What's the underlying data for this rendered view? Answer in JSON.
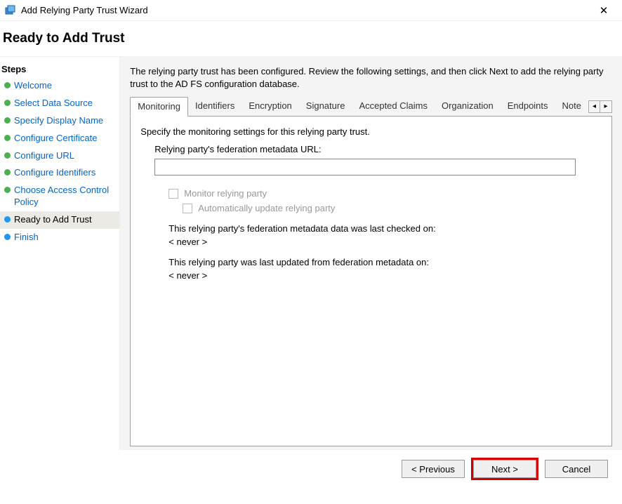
{
  "window": {
    "title": "Add Relying Party Trust Wizard"
  },
  "header": "Ready to Add Trust",
  "sidebar": {
    "title": "Steps",
    "steps": [
      {
        "label": "Welcome",
        "state": "done"
      },
      {
        "label": "Select Data Source",
        "state": "done"
      },
      {
        "label": "Specify Display Name",
        "state": "done"
      },
      {
        "label": "Configure Certificate",
        "state": "done"
      },
      {
        "label": "Configure URL",
        "state": "done"
      },
      {
        "label": "Configure Identifiers",
        "state": "done"
      },
      {
        "label": "Choose Access Control Policy",
        "state": "done"
      },
      {
        "label": "Ready to Add Trust",
        "state": "current"
      },
      {
        "label": "Finish",
        "state": "pending"
      }
    ]
  },
  "main": {
    "intro": "The relying party trust has been configured. Review the following settings, and then click Next to add the relying party trust to the AD FS configuration database.",
    "tabs": [
      {
        "label": "Monitoring",
        "active": true
      },
      {
        "label": "Identifiers"
      },
      {
        "label": "Encryption"
      },
      {
        "label": "Signature"
      },
      {
        "label": "Accepted Claims"
      },
      {
        "label": "Organization"
      },
      {
        "label": "Endpoints"
      },
      {
        "label": "Note"
      }
    ],
    "monitoring": {
      "desc": "Specify the monitoring settings for this relying party trust.",
      "url_label": "Relying party's federation metadata URL:",
      "url_value": "",
      "cb_monitor": "Monitor relying party",
      "cb_autoupdate": "Automatically update relying party",
      "last_checked_label": "This relying party's federation metadata data was last checked on:",
      "last_checked_value": "< never >",
      "last_updated_label": "This relying party was last updated from federation metadata on:",
      "last_updated_value": "< never >"
    }
  },
  "buttons": {
    "previous": "< Previous",
    "next": "Next >",
    "cancel": "Cancel"
  }
}
